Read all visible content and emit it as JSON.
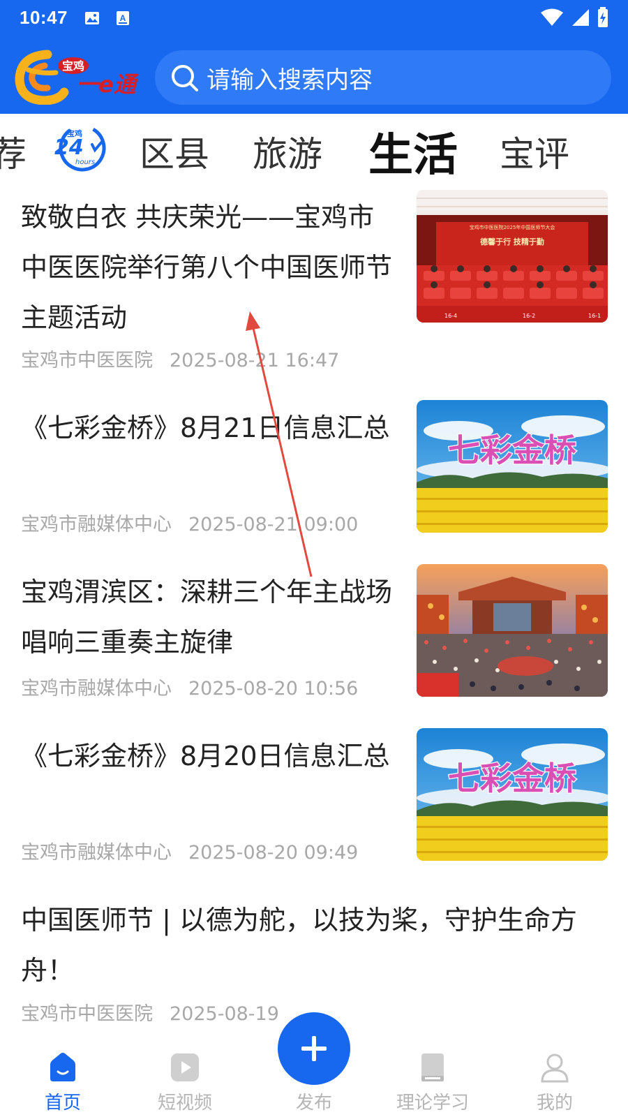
{
  "status_bar": {
    "time": "10:47"
  },
  "header": {
    "logo_text_top": "宝鸡",
    "logo_text_main": "一e通",
    "search_placeholder": "请输入搜索内容"
  },
  "tabs": {
    "items": [
      {
        "label": "荐"
      },
      {
        "label": "宝鸡24hours"
      },
      {
        "label": "区县"
      },
      {
        "label": "旅游"
      },
      {
        "label": "生活"
      },
      {
        "label": "宝评"
      }
    ],
    "active": "生活",
    "badge_24_text_top": "宝鸡",
    "badge_24_number": "24",
    "badge_24_text": "hours"
  },
  "feed": {
    "items": [
      {
        "title": "致敬白衣 共庆荣光——宝鸡市中医医院举行第八个中国医师节主题活动",
        "source": "宝鸡市中医医院",
        "time": "2025-08-21 16:47",
        "thumb_banner": "宝鸡市中医医院2025年中国医师节大会",
        "thumb_slogan": "德馨于行 技精于勤",
        "thumb_seats": [
          "16-4",
          "16-2",
          "16-1"
        ]
      },
      {
        "title": "《七彩金桥》8月21日信息汇总",
        "source": "宝鸡市融媒体中心",
        "time": "2025-08-21 09:00",
        "thumb_text": "七彩金桥"
      },
      {
        "title": "宝鸡渭滨区：深耕三个年主战场 唱响三重奏主旋律",
        "source": "宝鸡市融媒体中心",
        "time": "2025-08-20 10:56"
      },
      {
        "title": "《七彩金桥》8月20日信息汇总",
        "source": "宝鸡市融媒体中心",
        "time": "2025-08-20 09:49",
        "thumb_text": "七彩金桥"
      },
      {
        "title": "中国医师节 | 以德为舵，以技为桨，守护生命方舟！",
        "source": "宝鸡市中医医院",
        "time": "2025-08-19"
      }
    ]
  },
  "bottom_nav": {
    "items": [
      {
        "label": "首页",
        "icon": "home-icon"
      },
      {
        "label": "短视频",
        "icon": "video-icon"
      },
      {
        "label": "发布",
        "icon": "plus-icon"
      },
      {
        "label": "理论学习",
        "icon": "book-icon"
      },
      {
        "label": "我的",
        "icon": "user-icon"
      }
    ],
    "active": "首页"
  },
  "colors": {
    "brand_blue": "#1767ef",
    "meta_gray": "#a8a8a8",
    "annotation_arrow": "#e04a3f"
  }
}
